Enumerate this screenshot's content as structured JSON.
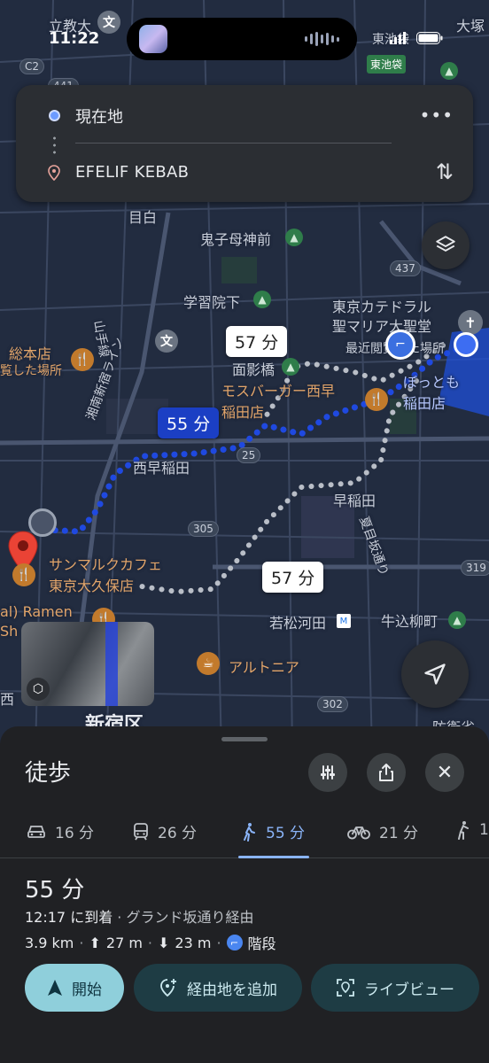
{
  "status_bar": {
    "time": "11:22",
    "signal_icon": "signal-icon",
    "battery_icon": "battery-icon"
  },
  "search": {
    "origin": "現在地",
    "destination": "EFELIF KEBAB",
    "more_icon": "more-icon",
    "swap_icon": "swap-icon"
  },
  "map": {
    "labels": {
      "kyoikudai": "立教大",
      "otsuka": "大塚",
      "higashi_ikebukuro_top": "東池袋",
      "higashi_ikebukuro_station": "東池袋",
      "mejiro": "目白",
      "kishimojin": "鬼子母神前",
      "gakushuin": "学習院下",
      "yamanote": "山手線",
      "tokyo_cathedral": "東京カテドラル\n聖マリア大聖堂",
      "recent": "最近閲覧した場所",
      "sohonten": "総本店",
      "visited": "覧した場所",
      "omokagebashi": "面影橋",
      "mos": "モスバーガー西早\n稲田店",
      "botto": "ぼっとも\n稲田店",
      "nishiwaseda": "西早稲田",
      "shonan": "湘南新宿ライン",
      "wasedadori": "早稲田",
      "natsume": "夏目坂通り",
      "sanmaruku": "サンマルクカフェ\n東京大久保店",
      "ramen": "al) Ramen\nSh",
      "wakamatsukawada": "若松河田",
      "ushigome": "牛込柳町",
      "arutonia": "アルトニア",
      "shinjuku_ku": "新宿区",
      "nishi": "西",
      "bouei": "防衛省"
    },
    "road_numbers": [
      "441",
      "437",
      "305",
      "302",
      "319",
      "25"
    ],
    "time_bubbles": [
      "57 分",
      "55 分",
      "57 分"
    ],
    "layers_icon": "layers-icon",
    "navigate_icon": "navigate-icon",
    "street_view_icon": "cube-icon"
  },
  "sheet": {
    "title": "徒歩",
    "filter_icon": "filter-icon",
    "share_icon": "share-icon",
    "close_icon": "close-icon",
    "tabs": [
      {
        "icon": "car-icon",
        "label": "16 分"
      },
      {
        "icon": "transit-icon",
        "label": "26 分"
      },
      {
        "icon": "walk-icon",
        "label": "55 分"
      },
      {
        "icon": "bike-icon",
        "label": "21 分"
      },
      {
        "icon": "person-icon",
        "label": "1"
      }
    ],
    "duration": "55 分",
    "arrival": "12:17 に到着",
    "via": " · グランド坂通り経由",
    "distance": "3.9 km",
    "ascent": "27 m",
    "descent": "23 m",
    "stairs": "階段",
    "dot": "·",
    "buttons": {
      "start": "開始",
      "add_stop": "経由地を追加",
      "live_view": "ライブビュー"
    },
    "colors": {
      "accent": "#8ab4f8",
      "start_bg": "#8fcfdb",
      "route": "#1b3fc4"
    }
  }
}
